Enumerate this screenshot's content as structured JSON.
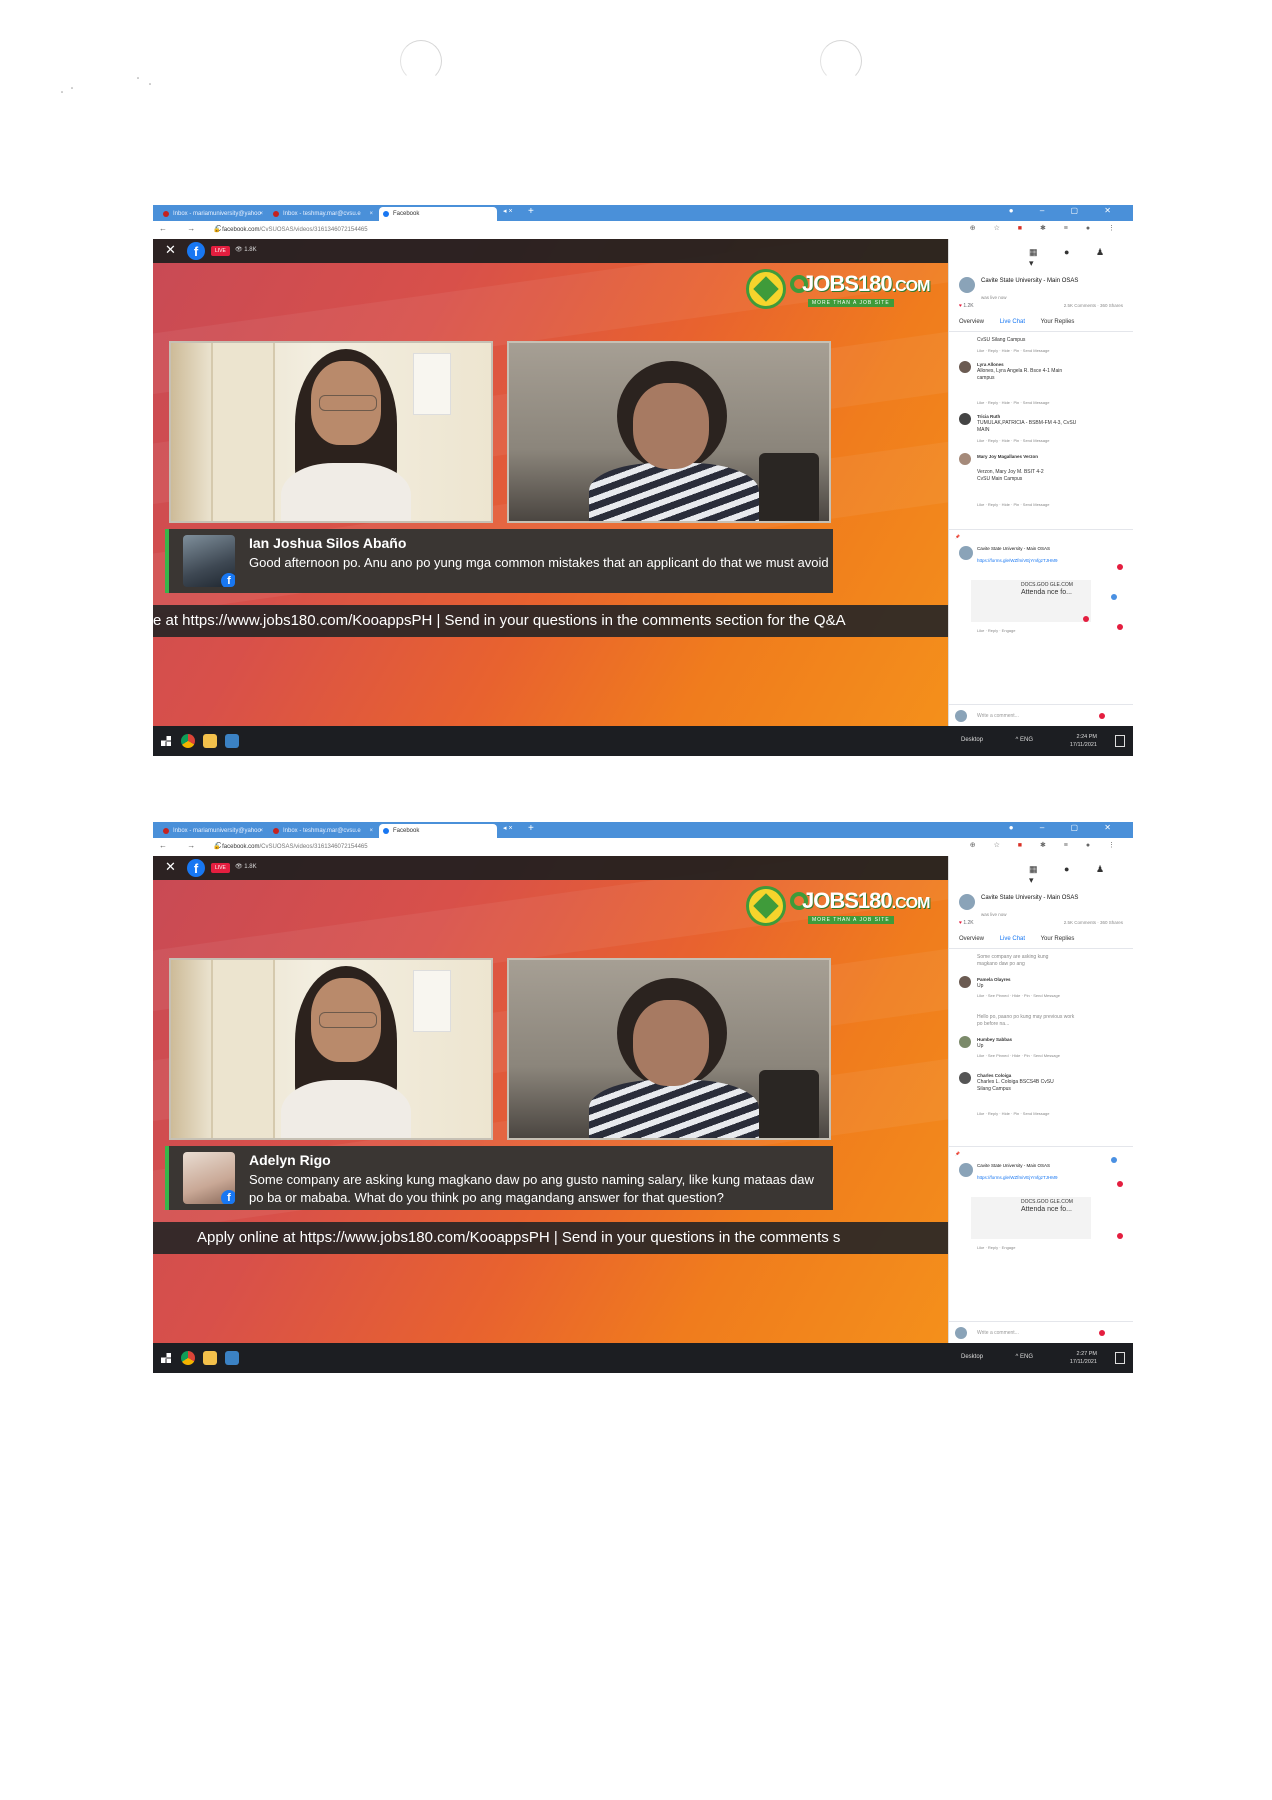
{
  "screenshots": [
    {
      "tabs": [
        {
          "label": "Inbox - mariamuniversity@yahoo"
        },
        {
          "label": "Inbox - teshmay.mar@cvsu.e"
        },
        {
          "label": "Facebook"
        }
      ],
      "url": {
        "domain": "facebook.com",
        "path": "/CvSUOSAS/videos/3161346072154465"
      },
      "video": {
        "live_label": "LIVE",
        "viewers": "1.8K"
      },
      "page": {
        "name": "Cavite State University - Main OSAS",
        "sub": "was live now",
        "reactions": "1.2K",
        "stats": "2.5K Comments · 360 Shares"
      },
      "panel_tabs": [
        "Overview",
        "Live Chat",
        "Your Replies"
      ],
      "chat": [
        {
          "name": "",
          "text": "CvSU Silang Campus",
          "meta": "Like · Reply · Hide · Pin · Send Message"
        },
        {
          "name": "Lyra Allones",
          "text": "Allones, Lyra Angela R. Bsce 4-1 Main campus",
          "meta": "Like · Reply · Hide · Pin · Send Message"
        },
        {
          "name": "Tricia Ruth",
          "text": "TUMULAK,PATRICIA - BSBM-FM 4-3, CvSU MAIN",
          "meta": "Like · Reply · Hide · Pin · Send Message"
        },
        {
          "name": "Mary Joy Magallanes Verzon",
          "text": "Verzon, Mary Joy M. BSIT 4-2 CvSU Main Campus",
          "meta": "Like · Reply · Hide · Pin · Send Message"
        }
      ],
      "pinned": {
        "page": "Cavite State University - Main OSAS",
        "link": "https://forms.gle/WZfmiVEjYmfgzTJHM9",
        "thumb": "DOCS.GOO GLE.COM",
        "thumb_title": "Attenda nce fo...",
        "meta": "Like · Reply · Engage"
      },
      "write_placeholder": "Write a comment...",
      "comment": {
        "name": "Ian Joshua Silos Abaño",
        "text": "Good afternoon po. Anu ano po yung mga common mistakes that an applicant do that we must avoid"
      },
      "ticker": "e at https://www.jobs180.com/KooappsPH | Send in your questions in the comments section for the Q&A",
      "taskbar": {
        "desktop": "Desktop",
        "lang": "ENG",
        "time": "2:24 PM",
        "date": "17/11/2021"
      }
    },
    {
      "tabs": [
        {
          "label": "Inbox - mariamuniversity@yahoo"
        },
        {
          "label": "Inbox - teshmay.mar@cvsu.e"
        },
        {
          "label": "Facebook"
        }
      ],
      "url": {
        "domain": "facebook.com",
        "path": "/CvSUOSAS/videos/3161346072154465"
      },
      "video": {
        "live_label": "LIVE",
        "viewers": "1.8K"
      },
      "page": {
        "name": "Cavite State University - Main OSAS",
        "sub": "was live now",
        "reactions": "1.2K",
        "stats": "2.5K Comments · 360 Shares"
      },
      "panel_tabs": [
        "Overview",
        "Live Chat",
        "Your Replies"
      ],
      "chat": [
        {
          "name": "",
          "text": "Some company are asking kung magkano daw po ang",
          "meta": ""
        },
        {
          "name": "Pamela Olayres",
          "text": "Up",
          "meta": "Like · See Pinned · Hide · Pin · Send Message"
        },
        {
          "name": "",
          "text": "Hello po, paano po kung may previous work po before na...",
          "meta": ""
        },
        {
          "name": "Humbey Sabbas",
          "text": "Up",
          "meta": "Like · See Pinned · Hide · Pin · Send Message"
        },
        {
          "name": "Charles Coloiga",
          "text": "Charles L. Coloiga BSCS4B CvSU Silang Campus",
          "meta": "Like · Reply · Hide · Pin · Send Message"
        }
      ],
      "pinned": {
        "page": "Cavite State University - Main OSAS",
        "link": "https://forms.gle/WZfmiVEjYmfgzTJHM9",
        "thumb": "DOCS.GOO GLE.COM",
        "thumb_title": "Attenda nce fo...",
        "meta": "Like · Reply · Engage"
      },
      "write_placeholder": "Write a comment...",
      "comment": {
        "name": "Adelyn Rigo",
        "text": "Some company are asking kung magkano daw po ang gusto naming salary, like kung mataas daw po ba or mababa. What do you think po ang magandang answer for that question?"
      },
      "ticker": "Apply online at https://www.jobs180.com/KooappsPH | Send in your questions in the comments s",
      "taskbar": {
        "desktop": "Desktop",
        "lang": "ENG",
        "time": "2:27 PM",
        "date": "17/11/2021"
      }
    }
  ],
  "brand": {
    "logo_text": "JOBS180",
    "logo_suffix": ".COM",
    "logo_tag": "MORE THAN A JOB SITE"
  },
  "colors": {
    "facebook_blue": "#1877f2",
    "live_red": "#e41e3f",
    "jobs_green": "#3f9b3a",
    "chrome_blue": "#4a90d9"
  }
}
